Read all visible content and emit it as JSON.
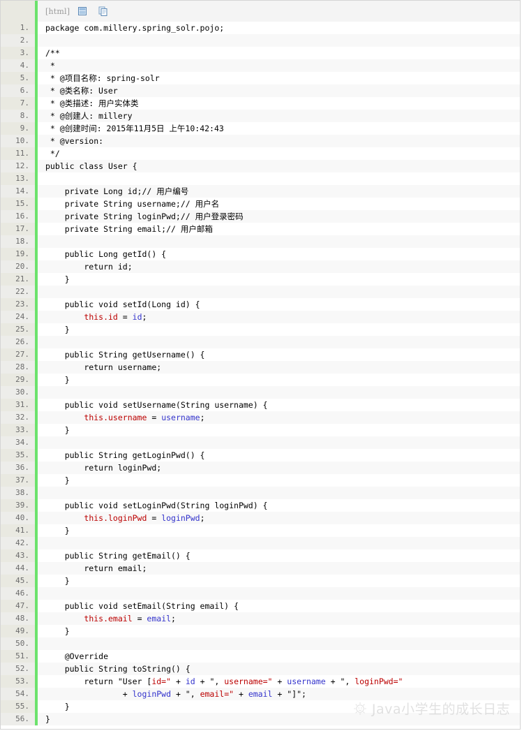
{
  "toolbar": {
    "language_label": "[html]",
    "icons": [
      {
        "name": "view-source-icon",
        "title": "view source"
      },
      {
        "name": "copy-to-clipboard-icon",
        "title": "copy to clipboard"
      }
    ]
  },
  "colors": {
    "gutter_bg": "#e9e9e1",
    "separator_bar": "#6ce26c",
    "row_alt_bg": "#f8f8f8",
    "string_literal": "#bb0000",
    "variable": "#3333cc",
    "plain_text": "#000000",
    "line_number": "#6c6c6c",
    "toolbar_label": "#9a9a9a",
    "watermark": "#c9c9c9"
  },
  "watermark": {
    "text": "Java小学生的成长日志",
    "icon": "sun-face-icon"
  },
  "code": {
    "language": "java",
    "total_lines": 56,
    "lines": [
      {
        "n": "1.",
        "tokens": [
          {
            "t": "package com.millery.spring_solr.pojo;",
            "c": "kw"
          }
        ]
      },
      {
        "n": "2.",
        "tokens": []
      },
      {
        "n": "3.",
        "tokens": [
          {
            "t": "/**",
            "c": "com"
          }
        ]
      },
      {
        "n": "4.",
        "tokens": [
          {
            "t": " *",
            "c": "com"
          }
        ]
      },
      {
        "n": "5.",
        "tokens": [
          {
            "t": " * @项目名称: spring-solr",
            "c": "com"
          }
        ]
      },
      {
        "n": "6.",
        "tokens": [
          {
            "t": " * @类名称: User",
            "c": "com"
          }
        ]
      },
      {
        "n": "7.",
        "tokens": [
          {
            "t": " * @类描述: 用户实体类",
            "c": "com"
          }
        ]
      },
      {
        "n": "8.",
        "tokens": [
          {
            "t": " * @创建人: millery",
            "c": "com"
          }
        ]
      },
      {
        "n": "9.",
        "tokens": [
          {
            "t": " * @创建时间: 2015年11月5日 上午10:42:43",
            "c": "com"
          }
        ]
      },
      {
        "n": "10.",
        "tokens": [
          {
            "t": " * @version:",
            "c": "com"
          }
        ]
      },
      {
        "n": "11.",
        "tokens": [
          {
            "t": " */",
            "c": "com"
          }
        ]
      },
      {
        "n": "12.",
        "tokens": [
          {
            "t": "public class User {",
            "c": "kw"
          }
        ]
      },
      {
        "n": "13.",
        "tokens": []
      },
      {
        "n": "14.",
        "tokens": [
          {
            "t": "    private Long id;// 用户编号",
            "c": "kw"
          }
        ]
      },
      {
        "n": "15.",
        "tokens": [
          {
            "t": "    private String username;// 用户名",
            "c": "kw"
          }
        ]
      },
      {
        "n": "16.",
        "tokens": [
          {
            "t": "    private String loginPwd;// 用户登录密码",
            "c": "kw"
          }
        ]
      },
      {
        "n": "17.",
        "tokens": [
          {
            "t": "    private String email;// 用户邮箱",
            "c": "kw"
          }
        ]
      },
      {
        "n": "18.",
        "tokens": []
      },
      {
        "n": "19.",
        "tokens": [
          {
            "t": "    public Long getId() {",
            "c": "kw"
          }
        ]
      },
      {
        "n": "20.",
        "tokens": [
          {
            "t": "        return id;",
            "c": "kw"
          }
        ]
      },
      {
        "n": "21.",
        "tokens": [
          {
            "t": "    }",
            "c": "kw"
          }
        ]
      },
      {
        "n": "22.",
        "tokens": []
      },
      {
        "n": "23.",
        "tokens": [
          {
            "t": "    public void setId(Long id) {",
            "c": "kw"
          }
        ]
      },
      {
        "n": "24.",
        "tokens": [
          {
            "t": "        ",
            "c": "kw"
          },
          {
            "t": "this.id",
            "c": "str"
          },
          {
            "t": " = ",
            "c": "kw"
          },
          {
            "t": "id",
            "c": "var"
          },
          {
            "t": ";",
            "c": "kw"
          }
        ]
      },
      {
        "n": "25.",
        "tokens": [
          {
            "t": "    }",
            "c": "kw"
          }
        ]
      },
      {
        "n": "26.",
        "tokens": []
      },
      {
        "n": "27.",
        "tokens": [
          {
            "t": "    public String getUsername() {",
            "c": "kw"
          }
        ]
      },
      {
        "n": "28.",
        "tokens": [
          {
            "t": "        return username;",
            "c": "kw"
          }
        ]
      },
      {
        "n": "29.",
        "tokens": [
          {
            "t": "    }",
            "c": "kw"
          }
        ]
      },
      {
        "n": "30.",
        "tokens": []
      },
      {
        "n": "31.",
        "tokens": [
          {
            "t": "    public void setUsername(String username) {",
            "c": "kw"
          }
        ]
      },
      {
        "n": "32.",
        "tokens": [
          {
            "t": "        ",
            "c": "kw"
          },
          {
            "t": "this.username",
            "c": "str"
          },
          {
            "t": " = ",
            "c": "kw"
          },
          {
            "t": "username",
            "c": "var"
          },
          {
            "t": ";",
            "c": "kw"
          }
        ]
      },
      {
        "n": "33.",
        "tokens": [
          {
            "t": "    }",
            "c": "kw"
          }
        ]
      },
      {
        "n": "34.",
        "tokens": []
      },
      {
        "n": "35.",
        "tokens": [
          {
            "t": "    public String getLoginPwd() {",
            "c": "kw"
          }
        ]
      },
      {
        "n": "36.",
        "tokens": [
          {
            "t": "        return loginPwd;",
            "c": "kw"
          }
        ]
      },
      {
        "n": "37.",
        "tokens": [
          {
            "t": "    }",
            "c": "kw"
          }
        ]
      },
      {
        "n": "38.",
        "tokens": []
      },
      {
        "n": "39.",
        "tokens": [
          {
            "t": "    public void setLoginPwd(String loginPwd) {",
            "c": "kw"
          }
        ]
      },
      {
        "n": "40.",
        "tokens": [
          {
            "t": "        ",
            "c": "kw"
          },
          {
            "t": "this.loginPwd",
            "c": "str"
          },
          {
            "t": " = ",
            "c": "kw"
          },
          {
            "t": "loginPwd",
            "c": "var"
          },
          {
            "t": ";",
            "c": "kw"
          }
        ]
      },
      {
        "n": "41.",
        "tokens": [
          {
            "t": "    }",
            "c": "kw"
          }
        ]
      },
      {
        "n": "42.",
        "tokens": []
      },
      {
        "n": "43.",
        "tokens": [
          {
            "t": "    public String getEmail() {",
            "c": "kw"
          }
        ]
      },
      {
        "n": "44.",
        "tokens": [
          {
            "t": "        return email;",
            "c": "kw"
          }
        ]
      },
      {
        "n": "45.",
        "tokens": [
          {
            "t": "    }",
            "c": "kw"
          }
        ]
      },
      {
        "n": "46.",
        "tokens": []
      },
      {
        "n": "47.",
        "tokens": [
          {
            "t": "    public void setEmail(String email) {",
            "c": "kw"
          }
        ]
      },
      {
        "n": "48.",
        "tokens": [
          {
            "t": "        ",
            "c": "kw"
          },
          {
            "t": "this.email",
            "c": "str"
          },
          {
            "t": " = ",
            "c": "kw"
          },
          {
            "t": "email",
            "c": "var"
          },
          {
            "t": ";",
            "c": "kw"
          }
        ]
      },
      {
        "n": "49.",
        "tokens": [
          {
            "t": "    }",
            "c": "kw"
          }
        ]
      },
      {
        "n": "50.",
        "tokens": []
      },
      {
        "n": "51.",
        "tokens": [
          {
            "t": "    @Override",
            "c": "kw"
          }
        ]
      },
      {
        "n": "52.",
        "tokens": [
          {
            "t": "    public String toString() {",
            "c": "kw"
          }
        ]
      },
      {
        "n": "53.",
        "tokens": [
          {
            "t": "        return ",
            "c": "kw"
          },
          {
            "t": "\"User [",
            "c": "kw"
          },
          {
            "t": "id=\"",
            "c": "str"
          },
          {
            "t": " + ",
            "c": "kw"
          },
          {
            "t": "id",
            "c": "var"
          },
          {
            "t": " + ",
            "c": "kw"
          },
          {
            "t": "\", ",
            "c": "kw"
          },
          {
            "t": "username=\"",
            "c": "str"
          },
          {
            "t": " + ",
            "c": "kw"
          },
          {
            "t": "username",
            "c": "var"
          },
          {
            "t": " + ",
            "c": "kw"
          },
          {
            "t": "\", ",
            "c": "kw"
          },
          {
            "t": "loginPwd=\"",
            "c": "str"
          }
        ]
      },
      {
        "n": "54.",
        "tokens": [
          {
            "t": "                + ",
            "c": "kw"
          },
          {
            "t": "loginPwd",
            "c": "var"
          },
          {
            "t": " + ",
            "c": "kw"
          },
          {
            "t": "\", ",
            "c": "kw"
          },
          {
            "t": "email=\"",
            "c": "str"
          },
          {
            "t": " + ",
            "c": "kw"
          },
          {
            "t": "email",
            "c": "var"
          },
          {
            "t": " + ",
            "c": "kw"
          },
          {
            "t": "\"]\";",
            "c": "kw"
          }
        ]
      },
      {
        "n": "55.",
        "tokens": [
          {
            "t": "    }",
            "c": "kw"
          }
        ]
      },
      {
        "n": "56.",
        "tokens": [
          {
            "t": "}",
            "c": "kw"
          }
        ]
      }
    ]
  }
}
